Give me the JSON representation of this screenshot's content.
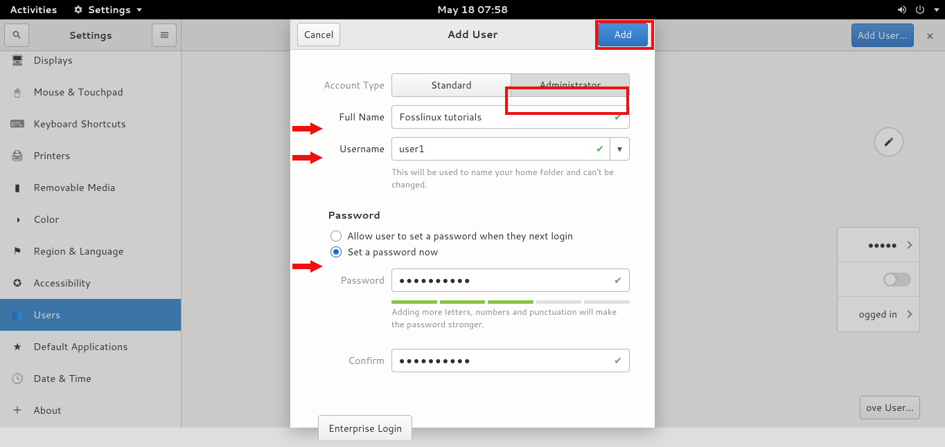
{
  "topbar": {
    "activities": "Activities",
    "menu": "Settings",
    "clock": "May 18  07:58"
  },
  "settings": {
    "title": "Settings",
    "addUserBtn": "Add User…"
  },
  "sidebar": {
    "items": [
      {
        "label": "Displays",
        "icon": "🖥"
      },
      {
        "label": "Mouse & Touchpad",
        "icon": "🖱"
      },
      {
        "label": "Keyboard Shortcuts",
        "icon": "⌨"
      },
      {
        "label": "Printers",
        "icon": "🖨"
      },
      {
        "label": "Removable Media",
        "icon": "💾"
      },
      {
        "label": "Color",
        "icon": "🎨"
      },
      {
        "label": "Region & Language",
        "icon": "⚑"
      },
      {
        "label": "Accessibility",
        "icon": "➕"
      },
      {
        "label": "Users",
        "icon": "👥",
        "active": true
      },
      {
        "label": "Default Applications",
        "icon": "★"
      },
      {
        "label": "Date & Time",
        "icon": "🕓"
      },
      {
        "label": "About",
        "icon": "＋"
      }
    ]
  },
  "peek": {
    "passwordLabel": "●●●●●",
    "loggedIn": "ogged in",
    "removeUser": "ove User…"
  },
  "dialog": {
    "cancel": "Cancel",
    "title": "Add User",
    "add": "Add",
    "accountType": "Account Type",
    "standard": "Standard",
    "administrator": "Administrator",
    "fullNameLabel": "Full Name",
    "fullNameValue": "Fosslinux tutorials",
    "usernameLabel": "Username",
    "usernameValue": "user1",
    "usernameHint": "This will be used to name your home folder and can't be changed.",
    "passwordSection": "Password",
    "radioNext": "Allow user to set a password when they next login",
    "radioNow": "Set a password now",
    "passwordLabel": "Password",
    "passwordValue": "●●●●●●●●●●",
    "passwordHint": "Adding more letters, numbers and punctuation will make the password stronger.",
    "confirmLabel": "Confirm",
    "confirmValue": "●●●●●●●●●●",
    "enterprise": "Enterprise Login"
  }
}
